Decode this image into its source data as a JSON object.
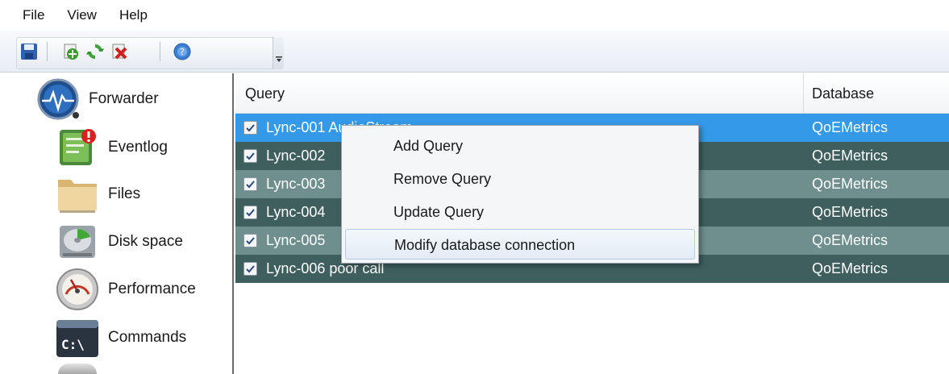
{
  "menu": [
    "File",
    "View",
    "Help"
  ],
  "toolbar": {
    "buttons": [
      "save-icon",
      "add-icon",
      "refresh-icon",
      "delete-icon",
      "help-icon"
    ]
  },
  "sidebar": {
    "items": [
      {
        "label": "Forwarder",
        "icon": "forwarder-icon"
      },
      {
        "label": "Eventlog",
        "icon": "eventlog-icon"
      },
      {
        "label": "Files",
        "icon": "folder-icon"
      },
      {
        "label": "Disk space",
        "icon": "disk-icon"
      },
      {
        "label": "Performance",
        "icon": "gauge-icon"
      },
      {
        "label": "Commands",
        "icon": "command-prompt-icon"
      }
    ]
  },
  "grid": {
    "headers": {
      "query": "Query",
      "database": "Database"
    },
    "rows": [
      {
        "query": "Lync-001 AudioStream",
        "database": "QoEMetrics",
        "checked": true
      },
      {
        "query": "Lync-002",
        "database": "QoEMetrics",
        "checked": true
      },
      {
        "query": "Lync-003",
        "database": "QoEMetrics",
        "checked": true
      },
      {
        "query": "Lync-004",
        "database": "QoEMetrics",
        "checked": true
      },
      {
        "query": "Lync-005",
        "database": "QoEMetrics",
        "checked": true
      },
      {
        "query": "Lync-006 poor call",
        "database": "QoEMetrics",
        "checked": true
      }
    ]
  },
  "context_menu": {
    "items": [
      "Add Query",
      "Remove Query",
      "Update Query",
      "Modify database connection"
    ]
  },
  "colors": {
    "selected_row": "#3399e8",
    "row_dark": "#3f5f5f",
    "row_light": "#6f8f8f"
  }
}
